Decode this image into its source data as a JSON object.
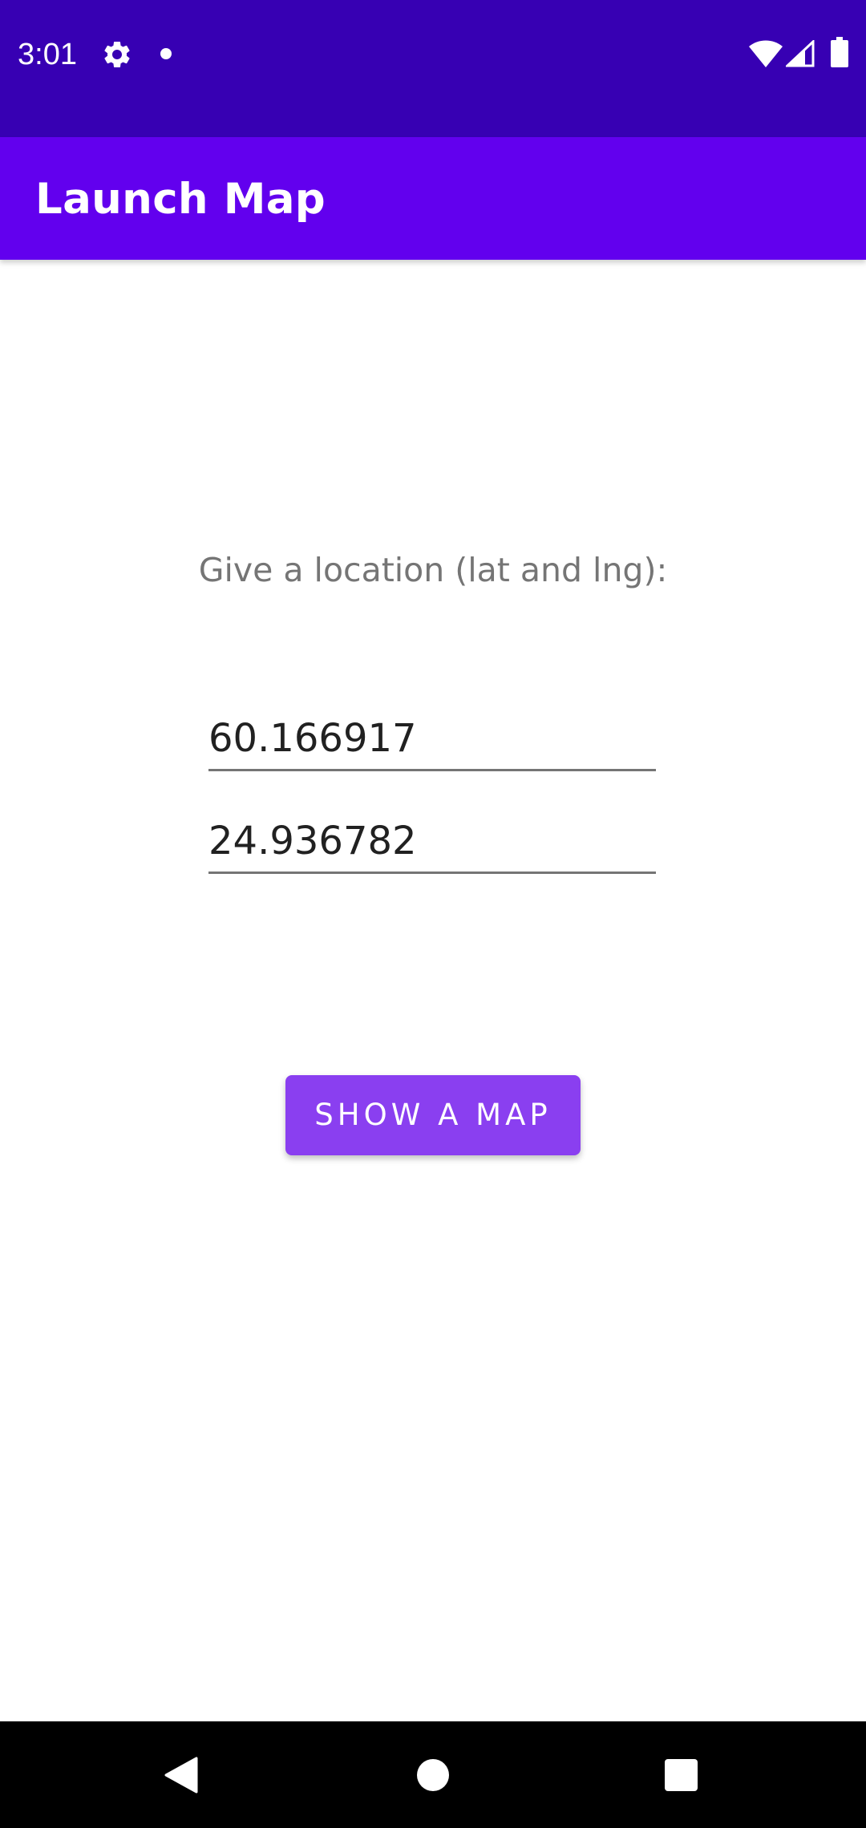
{
  "status_bar": {
    "time": "3:01",
    "icons": [
      "gear-icon",
      "notification-dot-icon",
      "wifi-icon",
      "signal-icon",
      "battery-icon"
    ],
    "background": "#3700b3"
  },
  "app_bar": {
    "title": "Launch Map",
    "background": "#6200ee"
  },
  "main": {
    "prompt": "Give a location (lat and lng):",
    "latitude_value": "60.166917",
    "longitude_value": "24.936782",
    "show_map_button": "SHOW A MAP",
    "button_color": "#8a3ff0"
  },
  "nav_bar": {
    "icons": [
      "back-icon",
      "home-icon",
      "recents-icon"
    ]
  }
}
